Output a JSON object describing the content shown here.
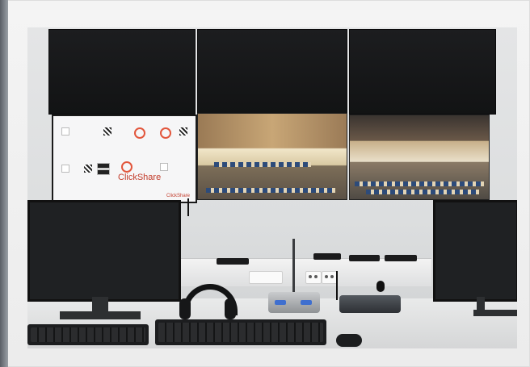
{
  "scene": {
    "description_labels": {
      "screen_brand": "ClickShare",
      "screen_footer": "ClickShare"
    }
  },
  "colors": {
    "frame": "#f4f4f4",
    "screen_dark": "#1c1d1f",
    "mic_button": "#3f6fcf",
    "brand_accent": "#c23b2a"
  },
  "icons": {
    "headphones": "headphones-icon",
    "microphone": "microphone-icon",
    "keyboard": "keyboard-icon",
    "mouse": "mouse-icon",
    "joystick": "joystick-icon"
  }
}
